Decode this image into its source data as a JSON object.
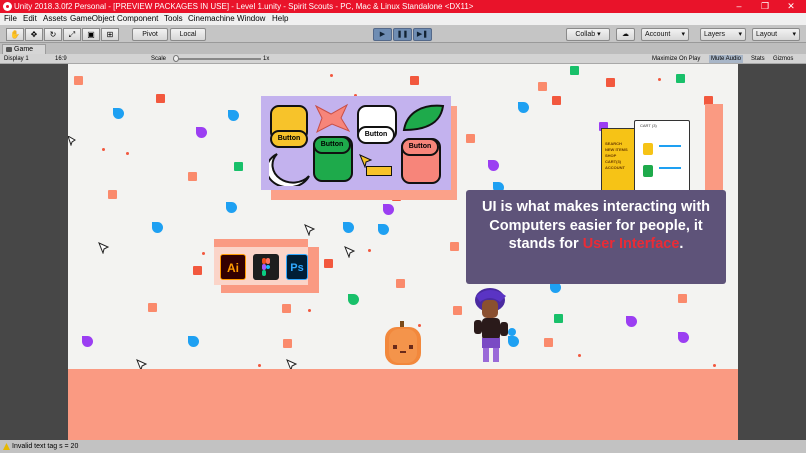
{
  "window": {
    "title": "Unity 2018.3.0f2 Personal - [PREVIEW PACKAGES IN USE] - Level 1.unity - Spirit Scouts - PC, Mac & Linux Standalone <DX11>",
    "controls": {
      "minimize": "–",
      "maximize": "❐",
      "close": "✕"
    }
  },
  "menu": [
    "File",
    "Edit",
    "Assets",
    "GameObject",
    "Component",
    "Tools",
    "Cinemachine",
    "Window",
    "Help"
  ],
  "toolbar": {
    "tools": [
      {
        "name": "hand-tool-icon",
        "glyph": "✋"
      },
      {
        "name": "move-tool-icon",
        "glyph": "✥"
      },
      {
        "name": "rotate-tool-icon",
        "glyph": "↻"
      },
      {
        "name": "scale-tool-icon",
        "glyph": "⤢"
      },
      {
        "name": "rect-tool-icon",
        "glyph": "▣"
      },
      {
        "name": "transform-tool-icon",
        "glyph": "⊞"
      }
    ],
    "pivot_label": "Pivot",
    "local_label": "Local",
    "play_glyph": "▶",
    "pause_glyph": "❚❚",
    "step_glyph": "▶❚",
    "collab_label": "Collab ▾",
    "cloud_glyph": "☁",
    "account_label": "Account",
    "layers_label": "Layers",
    "layout_label": "Layout"
  },
  "game_view": {
    "tab_label": "Game",
    "display": "Display 1",
    "aspect": "16:9",
    "scale_label": "Scale",
    "scale_value": "1x",
    "scale_fraction": 0.03,
    "options": [
      "Maximize On Play",
      "Mute Audio",
      "Stats",
      "Gizmos"
    ],
    "active_options": [
      "Mute Audio"
    ]
  },
  "scene": {
    "ui_buttons": [
      "Button",
      "Button",
      "Button",
      "Button"
    ],
    "apps": [
      {
        "label": "Ai",
        "fg": "#ff9a00",
        "bg": "#330000"
      },
      {
        "label": "Ps",
        "fg": "#31a8ff",
        "bg": "#001e36"
      }
    ],
    "message": {
      "text_before": "UI is what makes interacting with Computers easier for people, it stands for ",
      "highlight": "User Interface",
      "text_after": "."
    },
    "shop_menu": [
      "SEARCH",
      "NEW ITEMS",
      "SHOP",
      "CART(3)",
      "ACCOUNT"
    ],
    "shop_header": "CART (3)",
    "colors": {
      "background": "#f3f3f1",
      "ground": "#fa9a82",
      "panel": "#5e5379",
      "highlight": "#ea2b36",
      "confetti": [
        "#f2583e",
        "#1ea0f2",
        "#9b3ef2",
        "#18c06a",
        "#fa8a6c"
      ]
    }
  },
  "status": {
    "message": "Invalid text tag s = 20"
  }
}
